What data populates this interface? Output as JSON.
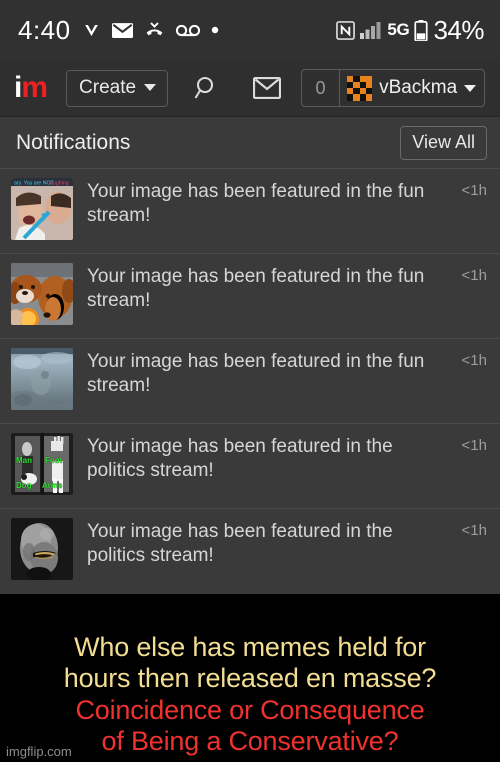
{
  "status_bar": {
    "time": "4:40",
    "left_icons": [
      "verizon-v-icon",
      "envelope-icon",
      "missed-call-icon",
      "voicemail-icon",
      "dot-icon"
    ],
    "right_icons": [
      "nfc-icon",
      "signal-bars-icon",
      "battery-icon"
    ],
    "network": "5G",
    "battery_percent": "34%"
  },
  "navbar": {
    "logo_first": "i",
    "logo_second": "m",
    "create_label": "Create",
    "search_icon": "search-icon",
    "mail_icon": "envelope-icon",
    "notification_count": "0",
    "username": "vBackma"
  },
  "panel": {
    "title": "Notifications",
    "view_all_label": "View All",
    "notifications": [
      {
        "text": "Your image has been featured in the fun stream!",
        "time": "<1h",
        "thumb": "laughing-people-thumbnail"
      },
      {
        "text": "Your image has been featured in the fun stream!",
        "time": "<1h",
        "thumb": "dogs-orange-thumbnail"
      },
      {
        "text": "Your image has been featured in the fun stream!",
        "time": "<1h",
        "thumb": "misty-blue-thumbnail"
      },
      {
        "text": "Your image has been featured in the politics stream!",
        "time": "<1h",
        "thumb": "labeled-bw-photo-thumbnail"
      },
      {
        "text": "Your image has been featured in the politics stream!",
        "time": "<1h",
        "thumb": "stone-face-thumbnail"
      }
    ],
    "thumb_labels": [
      "Man",
      "Foot",
      "Dog",
      "Arms"
    ]
  },
  "meme": {
    "line1": "Who else has memes held for",
    "line2": "hours then released en masse?",
    "line3": "Coincidence or Consequence",
    "line4": "of Being a Conservative?",
    "watermark": "imgflip.com",
    "color_top": "#f2dd91",
    "color_bottom": "#f0322f"
  }
}
